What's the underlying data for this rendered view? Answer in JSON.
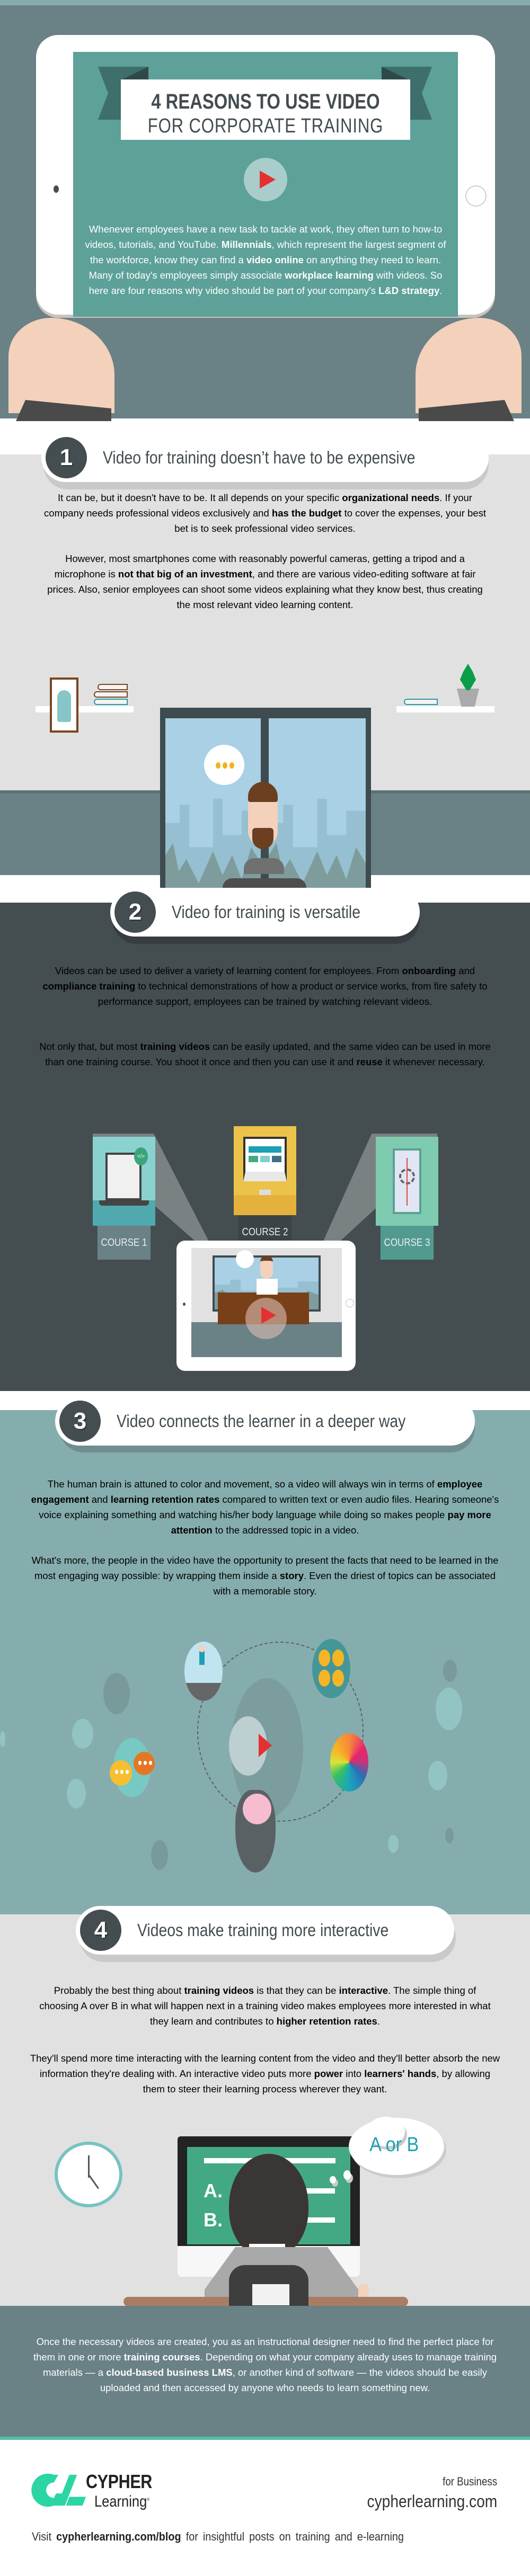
{
  "hero": {
    "title_line1": "4 REASONS TO USE VIDEO",
    "title_line2": "FOR CORPORATE TRAINING",
    "intro_segments": [
      {
        "text": "Whenever employees have a new task to tackle at work, they often turn to how-to videos, tutorials, and YouTube. ",
        "bold": false
      },
      {
        "text": "Millennials",
        "bold": true
      },
      {
        "text": ", which represent the largest segment of the workforce, know they can find a ",
        "bold": false
      },
      {
        "text": "video online",
        "bold": true
      },
      {
        "text": " on anything they need to learn. Many of today's employees simply associate ",
        "bold": false
      },
      {
        "text": "workplace learning",
        "bold": true
      },
      {
        "text": " with videos. So here are four reasons why video should be part of your company's ",
        "bold": false
      },
      {
        "text": "L&D strategy",
        "bold": true
      },
      {
        "text": ".",
        "bold": false
      }
    ],
    "play_icon": "play-icon"
  },
  "sections": [
    {
      "number": "1",
      "title": "Video for training doesn’t have to be expensive",
      "paragraphs": [
        [
          {
            "text": "It can be, but it doesn't have to be. It all depends on your specific ",
            "bold": false
          },
          {
            "text": "organizational needs",
            "bold": true
          },
          {
            "text": ". If your company needs professional videos exclusively and ",
            "bold": false
          },
          {
            "text": "has the budget",
            "bold": true
          },
          {
            "text": " to cover the expenses, your best bet is to seek professional video services.",
            "bold": false
          }
        ],
        [
          {
            "text": "However, most smartphones come with reasonably powerful cameras, getting a tripod and a microphone is ",
            "bold": false
          },
          {
            "text": "not that big of an investment",
            "bold": true
          },
          {
            "text": ", and there are various video-editing software at fair prices. Also, senior employees can shoot some videos explaining what they know best, thus creating the most relevant video learning content.",
            "bold": false
          }
        ]
      ]
    },
    {
      "number": "2",
      "title": "Video for training is versatile",
      "paragraphs": [
        [
          {
            "text": "Videos can be used to deliver a variety of learning content for employees. From ",
            "bold": false
          },
          {
            "text": "onboarding",
            "bold": true
          },
          {
            "text": " and ",
            "bold": false
          },
          {
            "text": "compliance training",
            "bold": true
          },
          {
            "text": " to technical demonstrations of how a product or service works, from fire safety to performance support, employees can be trained by watching relevant videos.",
            "bold": false
          }
        ],
        [
          {
            "text": "Not only that, but most ",
            "bold": false
          },
          {
            "text": "training videos",
            "bold": true
          },
          {
            "text": " can be easily updated, and the same video can be used in more than one training course. You shoot it once and then you can use it and ",
            "bold": false
          },
          {
            "text": "reuse",
            "bold": true
          },
          {
            "text": " it whenever necessary.",
            "bold": false
          }
        ]
      ],
      "courses": [
        {
          "label": "COURSE 1",
          "color": "#8ad2cf",
          "label_bg": "#6a8185"
        },
        {
          "label": "COURSE 2",
          "color": "#ecc34a",
          "label_bg": "#3b4347"
        },
        {
          "label": "COURSE 3",
          "color": "#7ecbb0",
          "label_bg": "#529a90"
        }
      ]
    },
    {
      "number": "3",
      "title": "Video connects the learner in a deeper way",
      "paragraphs": [
        [
          {
            "text": "The human brain is attuned to color and movement, so a video will always win in terms of ",
            "bold": false
          },
          {
            "text": "employee engagement",
            "bold": true
          },
          {
            "text": " and ",
            "bold": false
          },
          {
            "text": "learning retention rates",
            "bold": true
          },
          {
            "text": " compared to written text or even audio files. Hearing someone's voice explaining something and watching his/her body language while doing so makes people ",
            "bold": false
          },
          {
            "text": "pay more attention",
            "bold": true
          },
          {
            "text": " to the addressed topic in a video.",
            "bold": false
          }
        ],
        [
          {
            "text": "What's more, the people in the video have the opportunity to present the facts that need to be learned in the most engaging way possible: by wrapping them inside a ",
            "bold": false
          },
          {
            "text": "story",
            "bold": true
          },
          {
            "text": ". Even the driest of topics can be associated with a memorable story.",
            "bold": false
          }
        ]
      ]
    },
    {
      "number": "4",
      "title": "Videos make training more interactive",
      "paragraphs": [
        [
          {
            "text": "Probably the best thing about ",
            "bold": false
          },
          {
            "text": "training videos",
            "bold": true
          },
          {
            "text": " is that they can be ",
            "bold": false
          },
          {
            "text": "interactive",
            "bold": true
          },
          {
            "text": ". The simple thing of choosing A over B in what will happen next in a training video makes employees more interested in what they learn and contributes to ",
            "bold": false
          },
          {
            "text": "higher retention rates",
            "bold": true
          },
          {
            "text": ".",
            "bold": false
          }
        ],
        [
          {
            "text": "They'll spend more time interacting with the learning content from the video and they'll better absorb the new information they're dealing with. An interactive video puts more ",
            "bold": false
          },
          {
            "text": "power",
            "bold": true
          },
          {
            "text": " into ",
            "bold": false
          },
          {
            "text": "learners' hands",
            "bold": true
          },
          {
            "text": ", by allowing them to steer their learning process wherever they want.",
            "bold": false
          }
        ]
      ],
      "thought_bubble": "A or B",
      "options": [
        "A.",
        "B."
      ]
    }
  ],
  "conclusion": [
    {
      "text": "Once the necessary videos are created, you as an instructional designer need to find the perfect place for them in one or more ",
      "bold": false
    },
    {
      "text": "training courses",
      "bold": true
    },
    {
      "text": ". Depending on what your company already uses to manage training materials — a ",
      "bold": false
    },
    {
      "text": "cloud-based business LMS",
      "bold": true
    },
    {
      "text": ", or another kind of software — the videos should be easily uploaded and then accessed by anyone who needs to learn something new.",
      "bold": false
    }
  ],
  "footer": {
    "logo_line1": "CYPHER",
    "logo_line2": "Learning",
    "registered": "®",
    "tagline": "for Business",
    "website": "cypherlearning.com",
    "visit_prefix": "Visit ",
    "visit_link": "cypherlearning.com/blog",
    "visit_suffix": " for insightful posts on training and e-learning"
  },
  "colors": {
    "hero_bg": "#6a8185",
    "teal_screen": "#5da199",
    "dark_slate": "#444d50",
    "light_gray": "#e1e1e1",
    "section3_bg": "#86adae",
    "play_red": "#e53032",
    "brand_green": "#2cd5a4"
  }
}
